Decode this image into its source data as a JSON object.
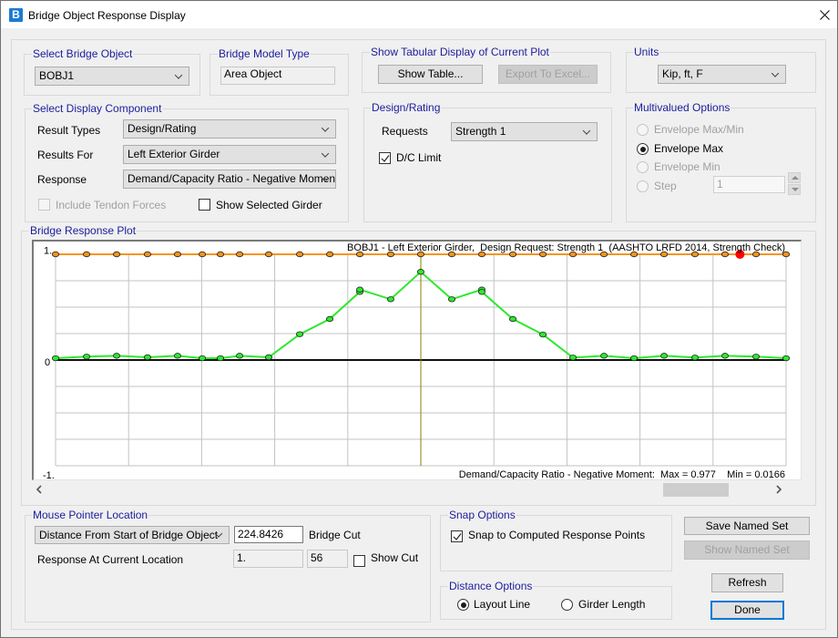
{
  "window": {
    "title": "Bridge Object Response Display",
    "icon_letter": "B"
  },
  "icons": {
    "app": "bridge-app-icon",
    "close": "close-icon",
    "dropdown": "chevron-down-icon",
    "check": "checkmark-icon",
    "scroll_left": "chevron-left-icon",
    "scroll_right": "chevron-right-icon",
    "spin_up": "arrow-up-icon",
    "spin_down": "arrow-down-icon"
  },
  "select_bridge_object": {
    "label": "Select Bridge Object",
    "value": "BOBJ1"
  },
  "bridge_model_type": {
    "label": "Bridge Model Type",
    "value": "Area Object"
  },
  "tabular_display": {
    "label": "Show Tabular Display of Current Plot",
    "show_table": "Show Table...",
    "export_excel": "Export To Excel...",
    "export_disabled": true
  },
  "units": {
    "label": "Units",
    "value": "Kip, ft, F"
  },
  "display_component": {
    "label": "Select Display Component",
    "result_types_label": "Result Types",
    "result_types": "Design/Rating",
    "results_for_label": "Results For",
    "results_for": "Left Exterior Girder",
    "response_label": "Response",
    "response": "Demand/Capacity Ratio - Negative Moment",
    "include_tendon": {
      "label": "Include Tendon Forces",
      "checked": false,
      "disabled": true
    },
    "show_selected_girder": {
      "label": "Show Selected Girder",
      "checked": false
    }
  },
  "design_rating": {
    "label": "Design/Rating",
    "requests_label": "Requests",
    "requests": "Strength 1",
    "dc_limit": {
      "label": "D/C Limit",
      "checked": true
    }
  },
  "multivalued": {
    "label": "Multivalued Options",
    "options": [
      {
        "label": "Envelope Max/Min",
        "selected": false,
        "disabled": true
      },
      {
        "label": "Envelope Max",
        "selected": true,
        "disabled": false
      },
      {
        "label": "Envelope Min",
        "selected": false,
        "disabled": true
      },
      {
        "label": "Step",
        "selected": false,
        "disabled": true
      }
    ],
    "step_value": "1"
  },
  "plot": {
    "label": "Bridge Response Plot"
  },
  "chart_data": {
    "type": "line",
    "title": "BOBJ1 - Left Exterior Girder,  Design Request: Strength 1  (AASHTO LRFD 2014, Strength Check)",
    "footer": "Demand/Capacity Ratio - Negative Moment:  Max = 0.977    Min = 0.0166",
    "xlabel": "",
    "ylabel": "",
    "x_range": [
      0,
      449.685
    ],
    "ylim": [
      -1,
      1
    ],
    "y_ticks": [
      1,
      0,
      -1
    ],
    "y_tick_labels": [
      "1.",
      "0",
      "-1."
    ],
    "grid": true,
    "x_grid_divisions": 10,
    "y_grid_step": 0.25,
    "cursor_x": 224.8426,
    "highlight_point": {
      "x": 421.3,
      "y": 1.0,
      "color": "#ff0000"
    },
    "cursor_color": "#808000",
    "stats": {
      "max": 0.977,
      "min": 0.0166
    },
    "series": [
      {
        "name": "D/C Limit",
        "color": "#f7941d",
        "points": [
          [
            0,
            1
          ],
          [
            19.1,
            1
          ],
          [
            37.6,
            1
          ],
          [
            56.6,
            1
          ],
          [
            75.1,
            1
          ],
          [
            90.3,
            1
          ],
          [
            101.5,
            1
          ],
          [
            113.3,
            1
          ],
          [
            131.2,
            1
          ],
          [
            150.3,
            1
          ],
          [
            168.8,
            1
          ],
          [
            187.3,
            1
          ],
          [
            206.3,
            1
          ],
          [
            224.8,
            1
          ],
          [
            243.9,
            1
          ],
          [
            262.4,
            1
          ],
          [
            281.5,
            1
          ],
          [
            300.0,
            1
          ],
          [
            318.5,
            1
          ],
          [
            337.6,
            1
          ],
          [
            356.1,
            1
          ],
          [
            374.6,
            1
          ],
          [
            393.6,
            1
          ],
          [
            412.1,
            1
          ],
          [
            431.2,
            1
          ],
          [
            449.7,
            1
          ]
        ]
      },
      {
        "name": "Demand/Capacity Ratio - Negative Moment",
        "color": "#2ee82e",
        "points": [
          [
            0,
            0.017
          ],
          [
            19.1,
            0.032
          ],
          [
            37.6,
            0.04
          ],
          [
            56.6,
            0.026
          ],
          [
            75.1,
            0.04
          ],
          [
            90.3,
            0.017
          ],
          [
            101.5,
            0.017
          ],
          [
            113.3,
            0.04
          ],
          [
            131.2,
            0.026
          ],
          [
            150.3,
            0.244
          ],
          [
            168.8,
            0.388
          ],
          [
            187.3,
            0.644
          ],
          [
            187.3,
            0.666
          ],
          [
            206.3,
            0.575
          ],
          [
            224.8,
            0.834
          ],
          [
            243.9,
            0.575
          ],
          [
            262.4,
            0.666
          ],
          [
            262.4,
            0.644
          ],
          [
            281.5,
            0.388
          ],
          [
            300.0,
            0.241
          ],
          [
            318.5,
            0.023
          ],
          [
            337.6,
            0.04
          ],
          [
            356.1,
            0.017
          ],
          [
            374.6,
            0.04
          ],
          [
            393.6,
            0.023
          ],
          [
            412.1,
            0.04
          ],
          [
            431.2,
            0.032
          ],
          [
            449.7,
            0.017
          ]
        ]
      }
    ]
  },
  "mouse_pointer": {
    "label": "Mouse Pointer Location",
    "mode": "Distance From Start of Bridge Object",
    "distance_value": "224.8426",
    "bridge_cut_label": "Bridge Cut",
    "response_label": "Response At Current Location",
    "response_value": "1.",
    "point_index": "56",
    "show_cut": {
      "label": "Show Cut",
      "checked": false
    }
  },
  "snap": {
    "label": "Snap Options",
    "snap_to_points": {
      "label": "Snap to Computed Response Points",
      "checked": true
    }
  },
  "distance": {
    "label": "Distance Options",
    "options": [
      {
        "label": "Layout Line",
        "selected": true
      },
      {
        "label": "Girder Length",
        "selected": false
      }
    ]
  },
  "buttons": {
    "save_named_set": "Save Named Set",
    "show_named_set": "Show Named Set",
    "show_named_set_disabled": true,
    "refresh": "Refresh",
    "done": "Done"
  },
  "colors": {
    "accent": "#0078d7",
    "group_label": "#1c1c9c",
    "app_icon": "#1b7bd2"
  }
}
